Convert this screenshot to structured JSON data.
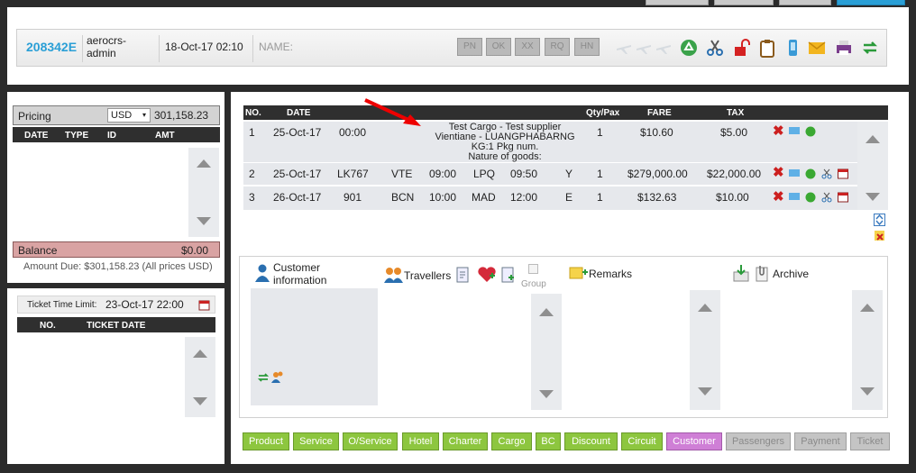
{
  "header": {
    "booking_ref": "208342E",
    "user": "aerocrs-\nadmin",
    "datetime": "18-Oct-17 02:10",
    "name_label": "NAME:",
    "flags": [
      "PN",
      "OK",
      "XX",
      "RQ",
      "HN"
    ],
    "tools": [
      "plane-icon",
      "plane-icon",
      "plane-icon",
      "recycle-icon",
      "scissors-icon",
      "unlock-icon",
      "clipboard-icon",
      "mobile-icon",
      "envelope-icon",
      "printer-icon",
      "exchange-icon"
    ]
  },
  "pricing": {
    "label": "Pricing",
    "currency": "USD",
    "amount": "301,158.23",
    "columns": [
      "DATE",
      "TYPE",
      "ID",
      "AMT"
    ],
    "balance_label": "Balance",
    "balance_value": "$0.00",
    "amount_due": "Amount Due: $301,158.23 (All prices USD)"
  },
  "ticket": {
    "time_limit_label": "Ticket Time Limit:",
    "time_limit_value": "23-Oct-17 22:00",
    "columns": [
      "NO.",
      "TICKET DATE"
    ]
  },
  "itinerary": {
    "columns": [
      "NO.",
      "DATE",
      "Qty/Pax",
      "FARE",
      "TAX"
    ],
    "rows": [
      {
        "no": "1",
        "date": "25-Oct-17",
        "time": "00:00",
        "desc1": "Test Cargo - Test supplier",
        "desc2": "Vientiane - LUANGPHABARNG",
        "desc3": "KG:1 Pkg num.",
        "desc4": "Nature of goods:",
        "qty": "1",
        "fare": "$10.60",
        "tax": "$5.00"
      },
      {
        "no": "2",
        "date": "25-Oct-17",
        "flight": "LK767",
        "from": "VTE",
        "dep": "09:00",
        "to": "LPQ",
        "arr": "09:50",
        "class": "Y",
        "qty": "1",
        "fare": "$279,000.00",
        "tax": "$22,000.00"
      },
      {
        "no": "3",
        "date": "26-Oct-17",
        "flight": "901",
        "from": "BCN",
        "dep": "10:00",
        "to": "MAD",
        "arr": "12:00",
        "class": "E",
        "qty": "1",
        "fare": "$132.63",
        "tax": "$10.00"
      }
    ]
  },
  "sections": {
    "customer_info": "Customer\ninformation",
    "travellers": "Travellers",
    "group": "Group",
    "remarks": "Remarks",
    "archive": "Archive"
  },
  "tabs": [
    {
      "label": "Product",
      "state": "normal"
    },
    {
      "label": "Service",
      "state": "normal"
    },
    {
      "label": "O/Service",
      "state": "normal"
    },
    {
      "label": "Hotel",
      "state": "normal"
    },
    {
      "label": "Charter",
      "state": "normal"
    },
    {
      "label": "Cargo",
      "state": "normal"
    },
    {
      "label": "BC",
      "state": "normal"
    },
    {
      "label": "Discount",
      "state": "normal"
    },
    {
      "label": "Circuit",
      "state": "normal"
    },
    {
      "label": "Customer",
      "state": "active"
    },
    {
      "label": "Passengers",
      "state": "disabled"
    },
    {
      "label": "Payment",
      "state": "disabled"
    },
    {
      "label": "Ticket",
      "state": "disabled"
    }
  ],
  "colors": {
    "accent_blue": "#2a9fd6",
    "tab_green": "#8dc63f",
    "tab_active": "#cf7fd6",
    "balance_bg": "#d9a3a3",
    "delete_red": "#cc1f1f"
  }
}
